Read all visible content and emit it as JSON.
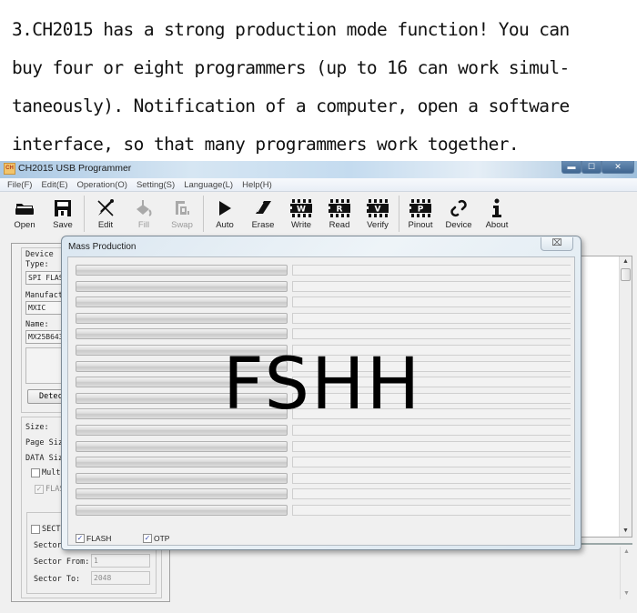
{
  "caption": {
    "lines": [
      "3.CH2015 has a strong production mode function! You can",
      "buy four or eight programmers (up to 16 can work simul-",
      "taneously). Notification of a computer, open a software",
      "interface, so that many programmers work together."
    ]
  },
  "window": {
    "title": "CH2015 USB Programmer",
    "app_icon_text": "CH",
    "controls": {
      "minimize": "▬",
      "maximize": "☐",
      "close": "✕"
    }
  },
  "menu": [
    {
      "label": "File(F)"
    },
    {
      "label": "Edit(E)"
    },
    {
      "label": "Operation(O)"
    },
    {
      "label": "Setting(S)"
    },
    {
      "label": "Language(L)"
    },
    {
      "label": "Help(H)"
    }
  ],
  "toolbar": [
    {
      "label": "Open",
      "icon": "folder-icon",
      "enabled": true
    },
    {
      "label": "Save",
      "icon": "floppy-icon",
      "enabled": true
    },
    {
      "label": "Edit",
      "icon": "pen-icon",
      "enabled": true
    },
    {
      "label": "Fill",
      "icon": "paint-bucket-icon",
      "enabled": false
    },
    {
      "label": "Swap",
      "icon": "swap-icon",
      "enabled": false
    },
    {
      "label": "Auto",
      "icon": "play-icon",
      "enabled": true
    },
    {
      "label": "Erase",
      "icon": "eraser-icon",
      "enabled": true
    },
    {
      "label": "Write",
      "icon": "chip-w-icon",
      "chip_letter": "W",
      "enabled": true
    },
    {
      "label": "Read",
      "icon": "chip-r-icon",
      "chip_letter": "R",
      "enabled": true
    },
    {
      "label": "Verify",
      "icon": "chip-v-icon",
      "chip_letter": "V",
      "enabled": true
    },
    {
      "label": "Pinout",
      "icon": "chip-p-icon",
      "chip_letter": "P",
      "enabled": true
    },
    {
      "label": "Device",
      "icon": "link-icon",
      "enabled": true
    },
    {
      "label": "About",
      "icon": "info-icon",
      "enabled": true
    }
  ],
  "left_panel": {
    "device_label": "Device",
    "type_label": "Type:",
    "type_value": "SPI FLAS",
    "manufacturer_label": "Manufactu",
    "manufacturer_value": "MXIC",
    "name_label": "Name:",
    "name_value": "MX25B643",
    "detect_button": "Detec",
    "size_label": "Size:",
    "page_size_label": "Page Siz",
    "data_size_label": "DATA Siz",
    "multi_label": "Mult",
    "multi_checked": false,
    "flash_label": "FLAS",
    "flash_checked": true,
    "sector_checkbox_label": "SECT",
    "sector_checked": false,
    "sector_label": "Sector",
    "sector_from_label": "Sector From:",
    "sector_from_value": "1",
    "sector_to_label": "Sector To:",
    "sector_to_value": "2048"
  },
  "dialog": {
    "title": "Mass Production",
    "close_glyph": "⌧",
    "programmers": [
      {
        "progress": 0,
        "status": ""
      },
      {
        "progress": 0,
        "status": ""
      },
      {
        "progress": 0,
        "status": ""
      },
      {
        "progress": 0,
        "status": ""
      },
      {
        "progress": 0,
        "status": ""
      },
      {
        "progress": 0,
        "status": ""
      },
      {
        "progress": 0,
        "status": ""
      },
      {
        "progress": 0,
        "status": ""
      },
      {
        "progress": 0,
        "status": ""
      },
      {
        "progress": 0,
        "status": ""
      },
      {
        "progress": 0,
        "status": ""
      },
      {
        "progress": 0,
        "status": ""
      },
      {
        "progress": 0,
        "status": ""
      },
      {
        "progress": 0,
        "status": ""
      },
      {
        "progress": 0,
        "status": ""
      },
      {
        "progress": 0,
        "status": ""
      }
    ],
    "flash_label": "FLASH",
    "flash_checked": true,
    "otp_label": "OTP",
    "otp_checked": true
  },
  "watermark": "FSHH",
  "glyphs": {
    "check": "✓",
    "scroll_up": "▲",
    "scroll_down": "▼"
  }
}
